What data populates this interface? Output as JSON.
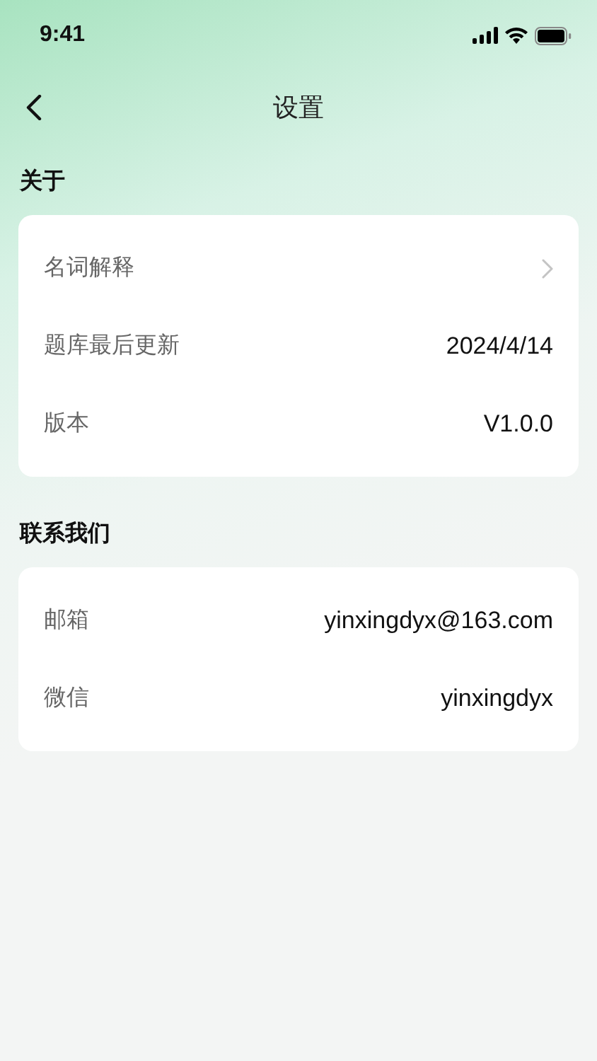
{
  "status_bar": {
    "time": "9:41"
  },
  "nav": {
    "title": "设置"
  },
  "sections": [
    {
      "title": "关于",
      "rows": [
        {
          "kind": "link",
          "label": "名词解释"
        },
        {
          "kind": "value",
          "label": "题库最后更新",
          "value": "2024/4/14"
        },
        {
          "kind": "value",
          "label": "版本",
          "value": "V1.0.0"
        }
      ]
    },
    {
      "title": "联系我们",
      "rows": [
        {
          "kind": "value",
          "label": "邮箱",
          "value": "yinxingdyx@163.com"
        },
        {
          "kind": "value",
          "label": "微信",
          "value": "yinxingdyx"
        }
      ]
    }
  ]
}
